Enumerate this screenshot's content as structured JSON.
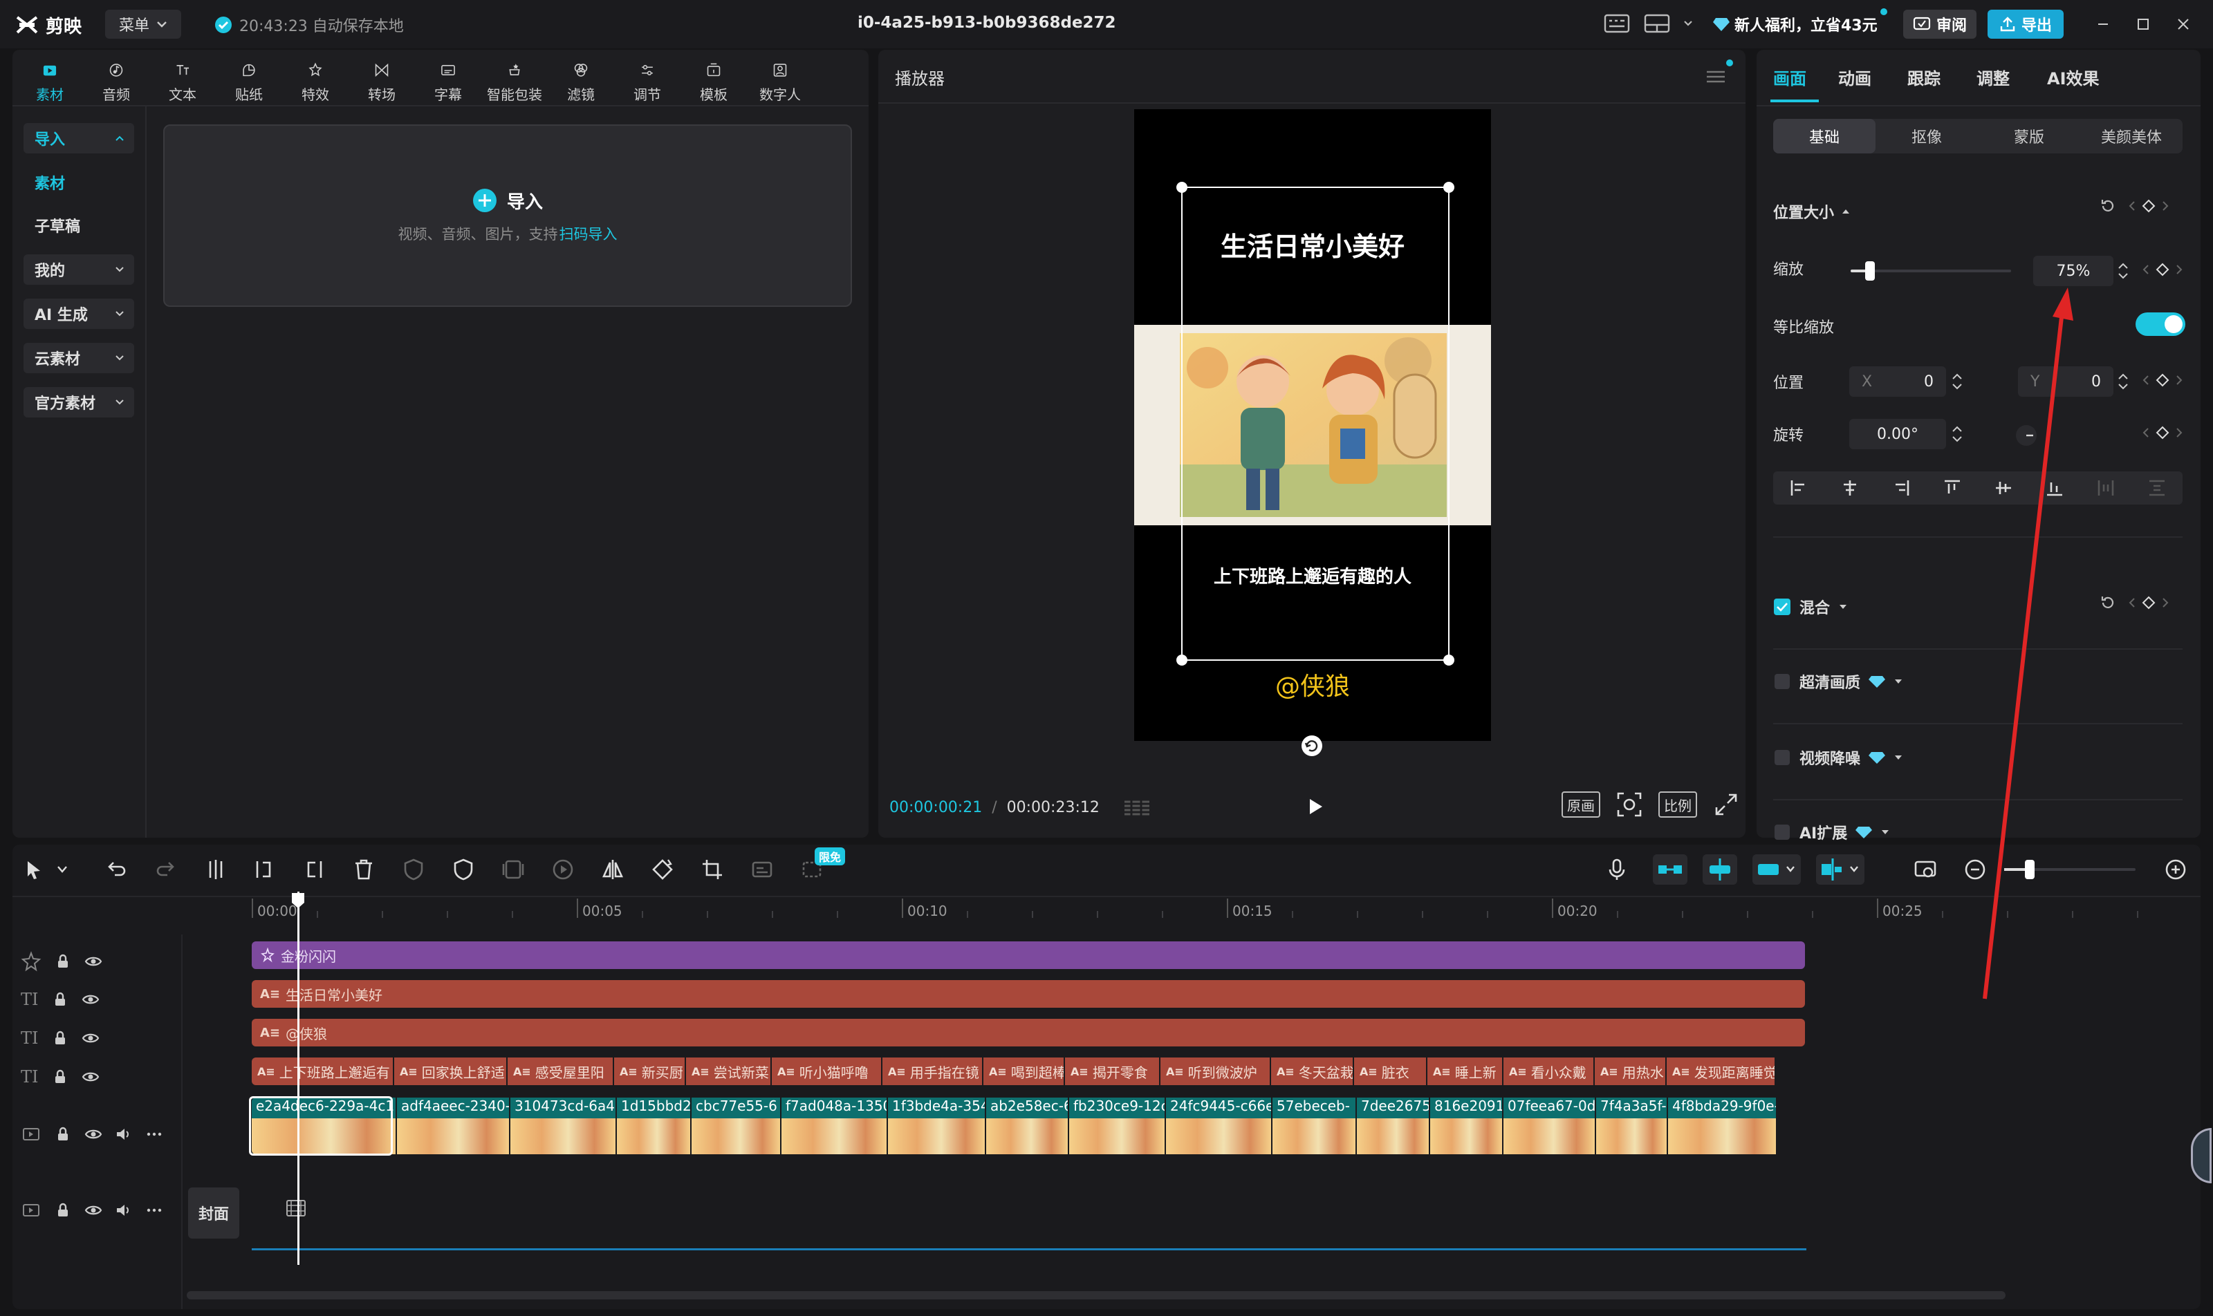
{
  "app": {
    "name": "剪映",
    "menu_label": "菜单",
    "autosave": "20:43:23 自动保存本地",
    "doc_title": "i0-4a25-b913-b0b9368de272",
    "promo": "新人福利，立省43元",
    "review_label": "审阅",
    "export_label": "导出",
    "accent": "#1ec6e0"
  },
  "media_toolbar": [
    {
      "label": "素材",
      "icon": "media-icon"
    },
    {
      "label": "音频",
      "icon": "audio-icon"
    },
    {
      "label": "文本",
      "icon": "text-icon"
    },
    {
      "label": "贴纸",
      "icon": "sticker-icon"
    },
    {
      "label": "特效",
      "icon": "effects-icon"
    },
    {
      "label": "转场",
      "icon": "transition-icon"
    },
    {
      "label": "字幕",
      "icon": "caption-icon"
    },
    {
      "label": "智能包装",
      "icon": "smart-pack-icon"
    },
    {
      "label": "滤镜",
      "icon": "filter-icon"
    },
    {
      "label": "调节",
      "icon": "adjust-icon"
    },
    {
      "label": "模板",
      "icon": "template-icon"
    },
    {
      "label": "数字人",
      "icon": "avatar-icon"
    }
  ],
  "sidebar": {
    "items": [
      {
        "label": "导入"
      },
      {
        "label": "素材"
      },
      {
        "label": "子草稿"
      },
      {
        "label": "我的"
      },
      {
        "label": "AI 生成"
      },
      {
        "label": "云素材"
      },
      {
        "label": "官方素材"
      }
    ]
  },
  "import_card": {
    "title": "导入",
    "hint": "视频、音频、图片，支持",
    "link": "扫码导入"
  },
  "player": {
    "header": "播放器",
    "video_title": "生活日常小美好",
    "video_subtitle": "上下班路上邂逅有趣的人",
    "video_handle": "@侠狼",
    "current_time": "00:00:00:21",
    "total_time": "00:00:23:12",
    "btn_original": "原画",
    "btn_ratio": "比例"
  },
  "props": {
    "tabs": [
      "画面",
      "动画",
      "跟踪",
      "调整",
      "AI效果"
    ],
    "subtabs": [
      "基础",
      "抠像",
      "蒙版",
      "美颜美体"
    ],
    "section_pos": "位置大小",
    "scale_label": "缩放",
    "scale_value": "75%",
    "scale_fraction": 0.75,
    "uniform_label": "等比缩放",
    "position_label": "位置",
    "x_label": "X",
    "x_value": "0",
    "y_label": "Y",
    "y_value": "0",
    "rotate_label": "旋转",
    "rotate_value": "0.00°",
    "blend_label": "混合",
    "hq_label": "超清画质",
    "denoise_label": "视频降噪",
    "ai_expand_label": "AI扩展"
  },
  "timeline": {
    "badge": "限免",
    "ruler": [
      "00:00",
      "00:05",
      "00:10",
      "00:15",
      "00:20",
      "00:25"
    ],
    "tracks": {
      "effect": "金粉闪闪",
      "title": "生活日常小美好",
      "handle": "@侠狼",
      "subtitles": [
        "上下班路上邂逅有",
        "回家换上舒适",
        "感受屋里阳",
        "新买厨",
        "尝试新菜",
        "听小猫呼噜",
        "用手指在镜",
        "喝到超棒",
        "揭开零食",
        "听到微波炉",
        "冬天盆栽",
        "脏衣",
        "睡上新",
        "看小众戴",
        "用热水",
        "发现距离睡觉"
      ],
      "videos": [
        "e2a4dec6-229a-4c1",
        "adf4aeec-2340-",
        "310473cd-6a4",
        "1d15bbd2",
        "cbc77e55-6",
        "f7ad048a-1350",
        "1f3bde4a-354",
        "ab2e58ec-6d",
        "fb230ce9-12c",
        "24fc9445-c66e",
        "57ebeceb-",
        "7dee2675",
        "816e2091",
        "07feea67-0d",
        "7f4a3a5f-",
        "4f8bda29-9f0e-"
      ],
      "cover_label": "封面"
    }
  }
}
